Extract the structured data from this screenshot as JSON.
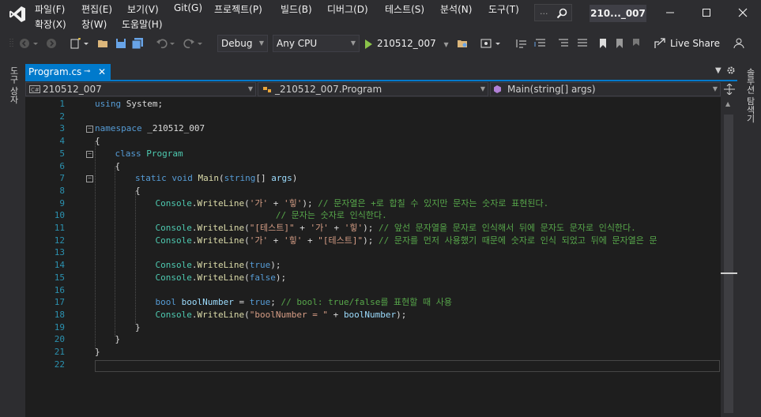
{
  "menu": {
    "items": [
      "파일(F)",
      "편집(E)",
      "보기(V)",
      "Git(G)",
      "프로젝트(P)",
      "빌드(B)",
      "디버그(D)",
      "테스트(S)",
      "분석(N)",
      "도구(T)",
      "확장(X)",
      "창(W)",
      "도움말(H)"
    ],
    "search_placeholder": "...",
    "solution_name": "210..._007"
  },
  "toolbar": {
    "config": "Debug",
    "platform": "Any CPU",
    "run_target": "210512_007",
    "live_share": "Live Share"
  },
  "side_tabs": {
    "left": "도구 상자",
    "right": "솔루션 탐색기"
  },
  "document": {
    "tab_title": "Program.cs",
    "pin_glyph": "⊸",
    "close_glyph": "✕"
  },
  "navbar": {
    "project": "210512_007",
    "type": "_210512_007.Program",
    "member": "Main(string[] args)"
  },
  "colors": {
    "accent": "#007acc",
    "editor_bg": "#1e1e1e",
    "chrome_bg": "#2d2d30",
    "keyword": "#569cd6",
    "type": "#4ec9b0",
    "string": "#d69d85",
    "comment": "#57a64a",
    "line_number": "#2b91af"
  },
  "code_lines": [
    {
      "n": "1",
      "t": [
        [
          "kw",
          "using"
        ],
        [
          "",
          " System;"
        ]
      ]
    },
    {
      "n": "2",
      "t": []
    },
    {
      "n": "3",
      "t": [
        [
          "kw",
          "namespace"
        ],
        [
          "",
          " _210512_007"
        ]
      ]
    },
    {
      "n": "4",
      "t": [
        [
          "",
          "{"
        ]
      ]
    },
    {
      "n": "5",
      "t": [
        [
          "kw",
          "class"
        ],
        [
          "",
          " "
        ],
        [
          "ty",
          "Program"
        ]
      ]
    },
    {
      "n": "6",
      "t": [
        [
          "",
          "{"
        ]
      ]
    },
    {
      "n": "7",
      "t": [
        [
          "kw",
          "static"
        ],
        [
          "",
          " "
        ],
        [
          "kw",
          "void"
        ],
        [
          "",
          " "
        ],
        [
          "mt",
          "Main"
        ],
        [
          "",
          "("
        ],
        [
          "kw",
          "string"
        ],
        [
          "",
          "[] "
        ],
        [
          "vr",
          "args"
        ],
        [
          "",
          ")"
        ]
      ]
    },
    {
      "n": "8",
      "t": [
        [
          "",
          "{"
        ]
      ]
    },
    {
      "n": "9",
      "t": [
        [
          "ty",
          "Console"
        ],
        [
          "",
          "."
        ],
        [
          "mt",
          "WriteLine"
        ],
        [
          "",
          "("
        ],
        [
          "str",
          "'가'"
        ],
        [
          "",
          " + "
        ],
        [
          "str",
          "'힣'"
        ],
        [
          "",
          "); "
        ],
        [
          "cm",
          "// 문자열은 +로 합칠 수 있지만 문자는 숫자로 표현된다."
        ]
      ]
    },
    {
      "n": "10",
      "t": [
        [
          "cm",
          "                       // 문자는 숫자로 인식한다."
        ]
      ]
    },
    {
      "n": "11",
      "t": [
        [
          "ty",
          "Console"
        ],
        [
          "",
          "."
        ],
        [
          "mt",
          "WriteLine"
        ],
        [
          "",
          "("
        ],
        [
          "str",
          "\"[테스트]\""
        ],
        [
          "",
          " + "
        ],
        [
          "str",
          "'가'"
        ],
        [
          "",
          " + "
        ],
        [
          "str",
          "'힣'"
        ],
        [
          "",
          "); "
        ],
        [
          "cm",
          "// 앞선 문자열을 문자로 인식해서 뒤에 문자도 문자로 인식한다."
        ]
      ]
    },
    {
      "n": "12",
      "t": [
        [
          "ty",
          "Console"
        ],
        [
          "",
          "."
        ],
        [
          "mt",
          "WriteLine"
        ],
        [
          "",
          "("
        ],
        [
          "str",
          "'가'"
        ],
        [
          "",
          " + "
        ],
        [
          "str",
          "'힣'"
        ],
        [
          "",
          " + "
        ],
        [
          "str",
          "\"[테스트]\""
        ],
        [
          "",
          "); "
        ],
        [
          "cm",
          "// 문자를 먼저 사용했기 때문에 숫자로 인식 되었고 뒤에 문자열은 문"
        ]
      ]
    },
    {
      "n": "13",
      "t": []
    },
    {
      "n": "14",
      "t": [
        [
          "ty",
          "Console"
        ],
        [
          "",
          "."
        ],
        [
          "mt",
          "WriteLine"
        ],
        [
          "",
          "("
        ],
        [
          "kw",
          "true"
        ],
        [
          "",
          ");"
        ]
      ]
    },
    {
      "n": "15",
      "t": [
        [
          "ty",
          "Console"
        ],
        [
          "",
          "."
        ],
        [
          "mt",
          "WriteLine"
        ],
        [
          "",
          "("
        ],
        [
          "kw",
          "false"
        ],
        [
          "",
          ");"
        ]
      ]
    },
    {
      "n": "16",
      "t": []
    },
    {
      "n": "17",
      "t": [
        [
          "kw",
          "bool"
        ],
        [
          "",
          " "
        ],
        [
          "vr",
          "boolNumber"
        ],
        [
          "",
          " = "
        ],
        [
          "kw",
          "true"
        ],
        [
          "",
          "; "
        ],
        [
          "cm",
          "// bool: true/false를 표현할 때 사용"
        ]
      ]
    },
    {
      "n": "18",
      "t": [
        [
          "ty",
          "Console"
        ],
        [
          "",
          "."
        ],
        [
          "mt",
          "WriteLine"
        ],
        [
          "",
          "("
        ],
        [
          "str",
          "\"boolNumber = \""
        ],
        [
          "",
          " + "
        ],
        [
          "vr",
          "boolNumber"
        ],
        [
          "",
          ");"
        ]
      ]
    },
    {
      "n": "19",
      "t": [
        [
          "",
          "}"
        ]
      ]
    },
    {
      "n": "20",
      "t": [
        [
          "",
          "}"
        ]
      ]
    },
    {
      "n": "21",
      "t": [
        [
          "",
          "}"
        ]
      ]
    },
    {
      "n": "22",
      "t": []
    }
  ]
}
